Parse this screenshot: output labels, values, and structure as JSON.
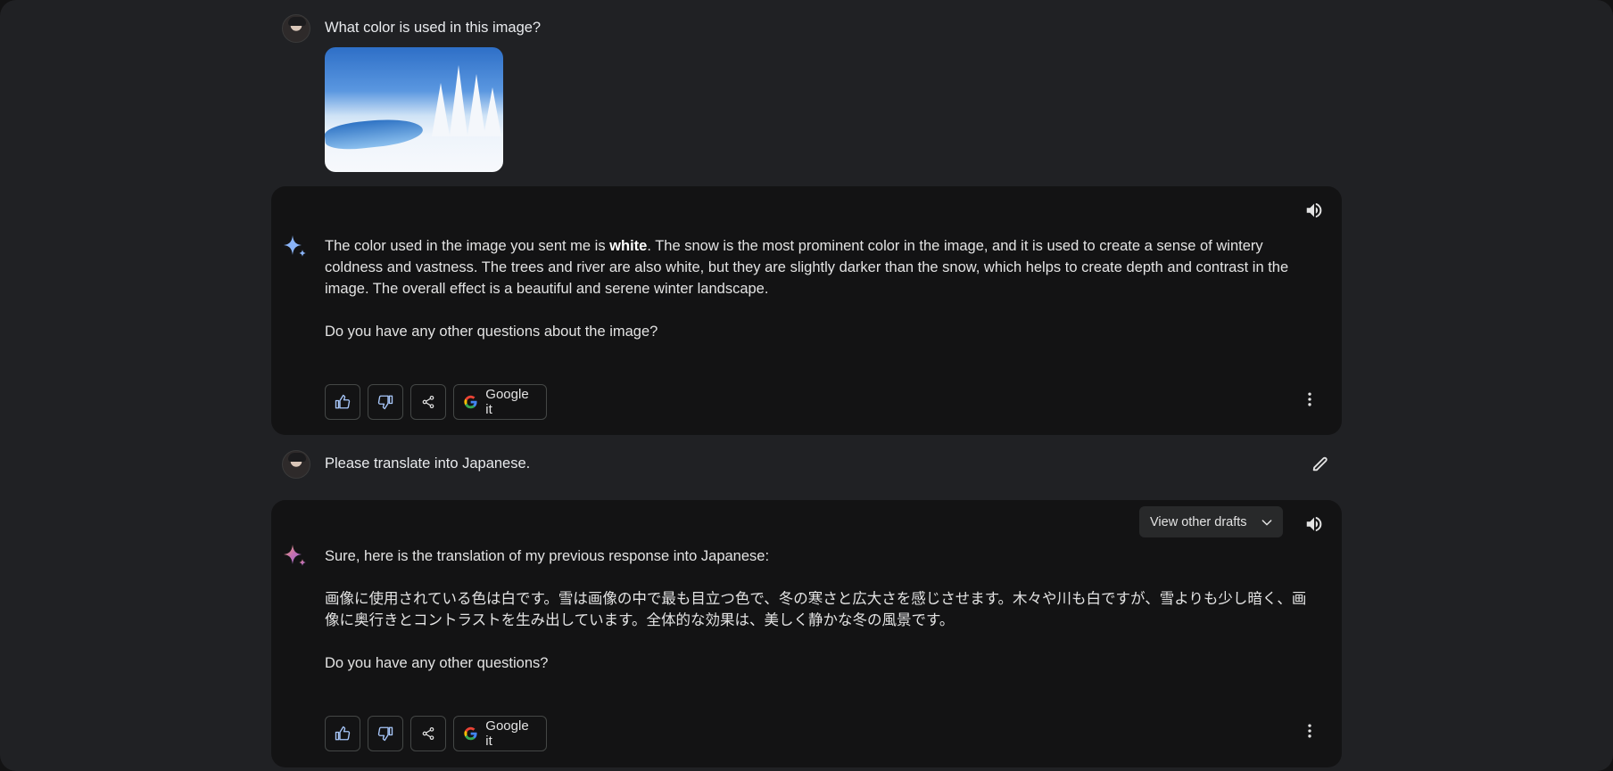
{
  "conversation": {
    "user_prompt_1": "What color is used in this image?",
    "response_1": {
      "para1_before_bold": "The color used in the image you sent me is ",
      "para1_bold": "white",
      "para1_after_bold": ". The snow is the most prominent color in the image, and it is used to create a sense of wintery coldness and vastness. The trees and river are also white, but they are slightly darker than the snow, which helps to create depth and contrast in the image. The overall effect is a beautiful and serene winter landscape.",
      "para2": "Do you have any other questions about the image?"
    },
    "user_prompt_2": "Please translate into Japanese.",
    "response_2": {
      "drafts_label": "View other drafts",
      "para1": "Sure, here is the translation of my previous response into Japanese:",
      "para2": "画像に使用されている色は白です。雪は画像の中で最も目立つ色で、冬の寒さと広大さを感じさせます。木々や川も白ですが、雪よりも少し暗く、画像に奥行きとコントラストを生み出しています。全体的な効果は、美しく静かな冬の風景です。",
      "para3": "Do you have any other questions?"
    }
  },
  "actions": {
    "google_it_label": "Google it"
  },
  "icons": {
    "thumbs_up": "thumbs-up-icon",
    "thumbs_down": "thumbs-down-icon",
    "share": "share-icon",
    "google": "google-g-icon",
    "more": "more-vert-icon",
    "speaker": "speaker-icon",
    "edit": "edit-pencil-icon",
    "sparkle": "gemini-sparkle-icon"
  },
  "colors": {
    "page_bg": "#202124",
    "card_bg": "#131314",
    "sparkle_blue": "#8ab4f8",
    "text": "#e3e3e3"
  }
}
